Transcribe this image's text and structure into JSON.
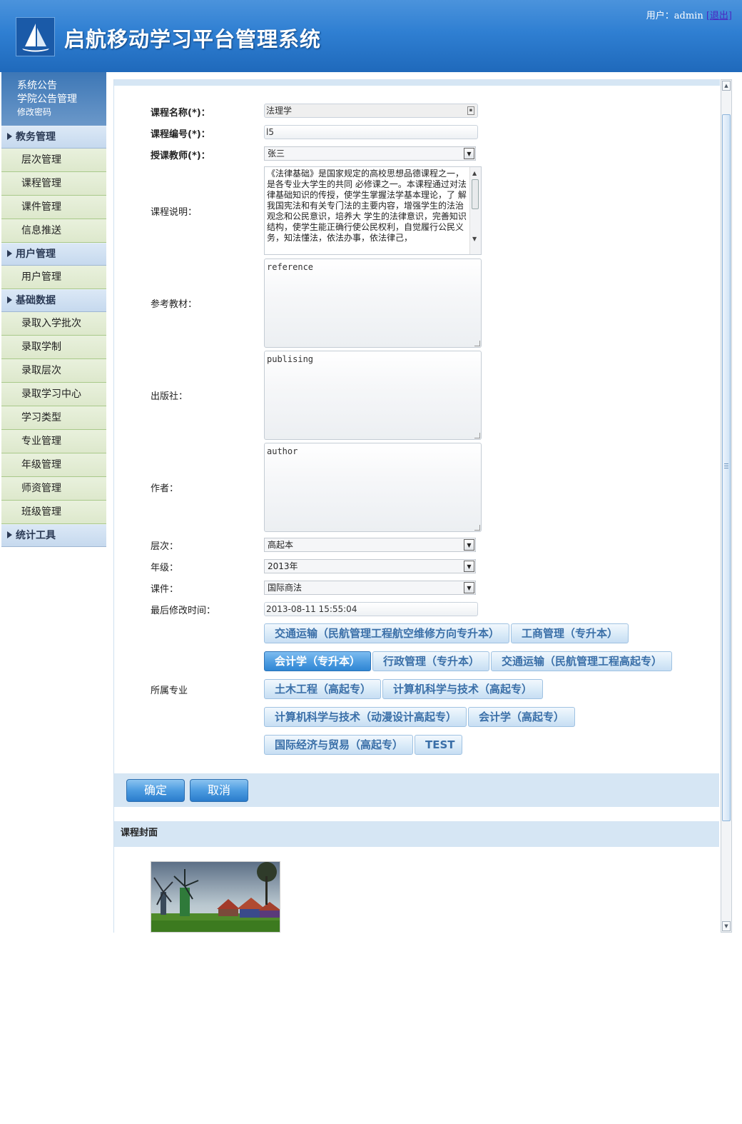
{
  "header": {
    "title": "启航移动学习平台管理系统",
    "user_label": "用户：",
    "user_name": "admin",
    "logout": "[退出]"
  },
  "sidebar": {
    "top_links": [
      "系统公告",
      "学院公告管理",
      "修改密码"
    ],
    "groups": [
      {
        "title": "教务管理",
        "items": [
          "层次管理",
          "课程管理",
          "课件管理",
          "信息推送"
        ]
      },
      {
        "title": "用户管理",
        "items": [
          "用户管理"
        ]
      },
      {
        "title": "基础数据",
        "items": [
          "录取入学批次",
          "录取学制",
          "录取层次",
          "录取学习中心",
          "学习类型",
          "专业管理",
          "年级管理",
          "师资管理",
          "班级管理"
        ]
      },
      {
        "title": "统计工具",
        "items": []
      }
    ]
  },
  "form": {
    "course_name_label": "课程名称(*)：",
    "course_name_value": "法理学",
    "course_code_label": "课程编号(*)：",
    "course_code_value": "l5",
    "teacher_label": "授课教师(*)：",
    "teacher_value": "张三",
    "desc_label": "课程说明：",
    "desc_value": "《法律基础》是国家规定的高校思想品德课程之一，是各专业大学生的共同 必修课之一。本课程通过对法律基础知识的传授，使学生掌握法学基本理论，了 解我国宪法和有关专门法的主要内容，增强学生的法治观念和公民意识，培养大 学生的法律意识，完善知识结构，使学生能正确行使公民权利，自觉履行公民义 务，知法懂法，依法办事，依法律己，",
    "ref_label": "参考教材：",
    "ref_value": "reference",
    "pub_label": "出版社：",
    "pub_value": "publising",
    "author_label": "作者：",
    "author_value": "author",
    "level_label": "层次：",
    "level_value": "高起本",
    "grade_label": "年级：",
    "grade_value": "2013年",
    "courseware_label": "课件：",
    "courseware_value": "国际商法",
    "modified_label": "最后修改时间：",
    "modified_value": "2013-08-11 15:55:04",
    "majors_label": "所属专业",
    "majors": [
      "交通运输（民航管理工程航空维修方向专升本）",
      "工商管理（专升本）",
      "会计学（专升本）",
      "行政管理（专升本）",
      "交通运输（民航管理工程高起专）",
      "土木工程（高起专）",
      "计算机科学与技术（高起专）",
      "计算机科学与技术（动漫设计高起专）",
      "会计学（高起专）",
      "国际经济与贸易（高起专）",
      "TEST"
    ],
    "selected_major": "会计学（专升本）"
  },
  "actions": {
    "ok": "确定",
    "cancel": "取消"
  },
  "cover": {
    "title": "课程封面"
  }
}
